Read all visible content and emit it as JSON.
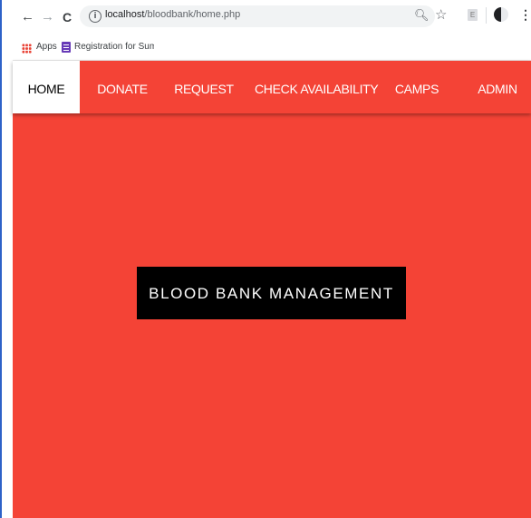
{
  "browser": {
    "url_host": "localhost",
    "url_path": "/bloodbank/home.php",
    "extension_label": "E",
    "icons": [
      "back-arrow-icon",
      "forward-arrow-icon",
      "reload-icon",
      "info-icon",
      "zoom-icon",
      "star-icon",
      "extension-icon",
      "profile-icon",
      "menu-icon"
    ]
  },
  "bookmarks": {
    "apps_label": "Apps",
    "item_label": "Registration for Sum"
  },
  "nav": {
    "items": [
      "HOME",
      "DONATE",
      "REQUEST",
      "CHECK AVAILABILITY",
      "CAMPS",
      "ADMIN"
    ],
    "active": "HOME"
  },
  "hero": {
    "title": "BLOOD BANK MANAGEMENT"
  },
  "colors": {
    "primary_red": "#f44336",
    "hero_bg": "#000000",
    "nav_active_bg": "#ffffff"
  }
}
